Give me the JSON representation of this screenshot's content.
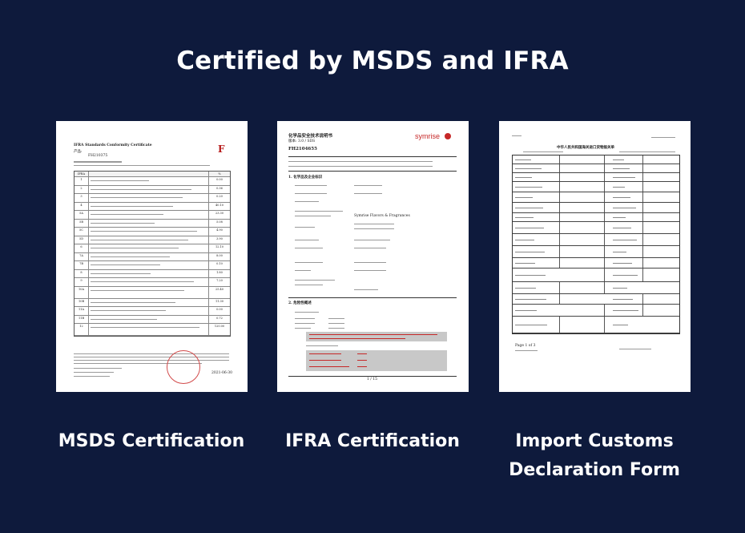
{
  "headline": "Certified by MSDS and IFRA",
  "docs": [
    {
      "caption": "MSDS Certification",
      "title": "IFRA Standards Conformity Certificate",
      "ref": "FH210375",
      "footer_date": "2021-06-30",
      "rows": [
        {
          "n": "1",
          "v": "0.00"
        },
        {
          "n": "2",
          "v": "0.36"
        },
        {
          "n": "3",
          "v": "0.20"
        },
        {
          "n": "4",
          "v": "40.10"
        },
        {
          "n": "5A",
          "v": "23.30"
        },
        {
          "n": "5B",
          "v": "5.08"
        },
        {
          "n": "5C",
          "v": "4.90"
        },
        {
          "n": "5D",
          "v": "3.90"
        },
        {
          "n": "6",
          "v": "12.10"
        },
        {
          "n": "7A",
          "v": "8.00"
        },
        {
          "n": "7B",
          "v": "0.10"
        },
        {
          "n": "8",
          "v": "1.80"
        },
        {
          "n": "9",
          "v": "7.20"
        },
        {
          "n": "10A",
          "v": "25.40"
        },
        {
          "n": "10B",
          "v": "11.30"
        },
        {
          "n": "11A",
          "v": "0.00"
        },
        {
          "n": "11B",
          "v": "0.72"
        },
        {
          "n": "12",
          "v": "120.00"
        }
      ]
    },
    {
      "caption": "IFRA Certification",
      "brand": "symrise",
      "title": "化学品安全技术说明书",
      "product_code": "FH2104655",
      "section1": "1. 化学品及企业标识",
      "section2": "2. 危险性概述",
      "company": "Symrise Flavors & Fragrances",
      "page": "1 / 15"
    },
    {
      "caption": "Import Customs Declaration Form",
      "title": "中华人民共和国海关进口货物报关单",
      "page_no": "Page 1 of 3"
    }
  ]
}
